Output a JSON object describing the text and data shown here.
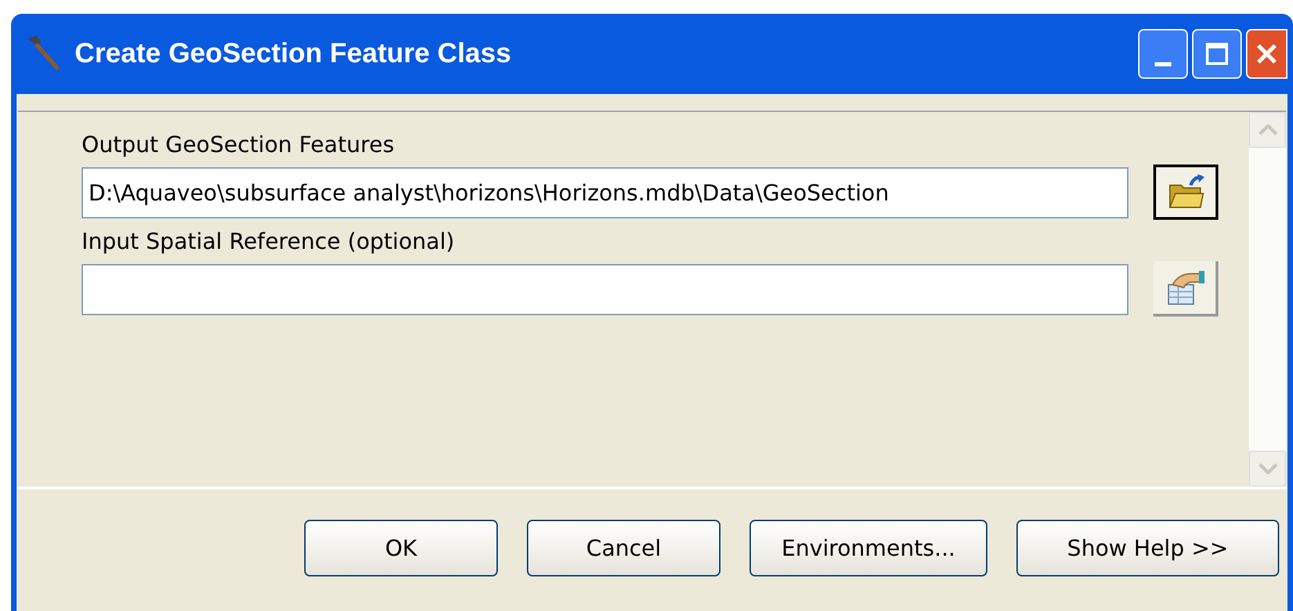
{
  "window": {
    "title": "Create GeoSection Feature Class"
  },
  "fields": [
    {
      "label": "Output GeoSection Features",
      "value": "D:\\Aquaveo\\subsurface analyst\\horizons\\Horizons.mdb\\Data\\GeoSection",
      "kind": "folder"
    },
    {
      "label": "Input Spatial Reference (optional)",
      "kind": "spatial"
    }
  ],
  "buttons": [
    "OK",
    "Cancel",
    "Environments...",
    "Show Help >>"
  ]
}
